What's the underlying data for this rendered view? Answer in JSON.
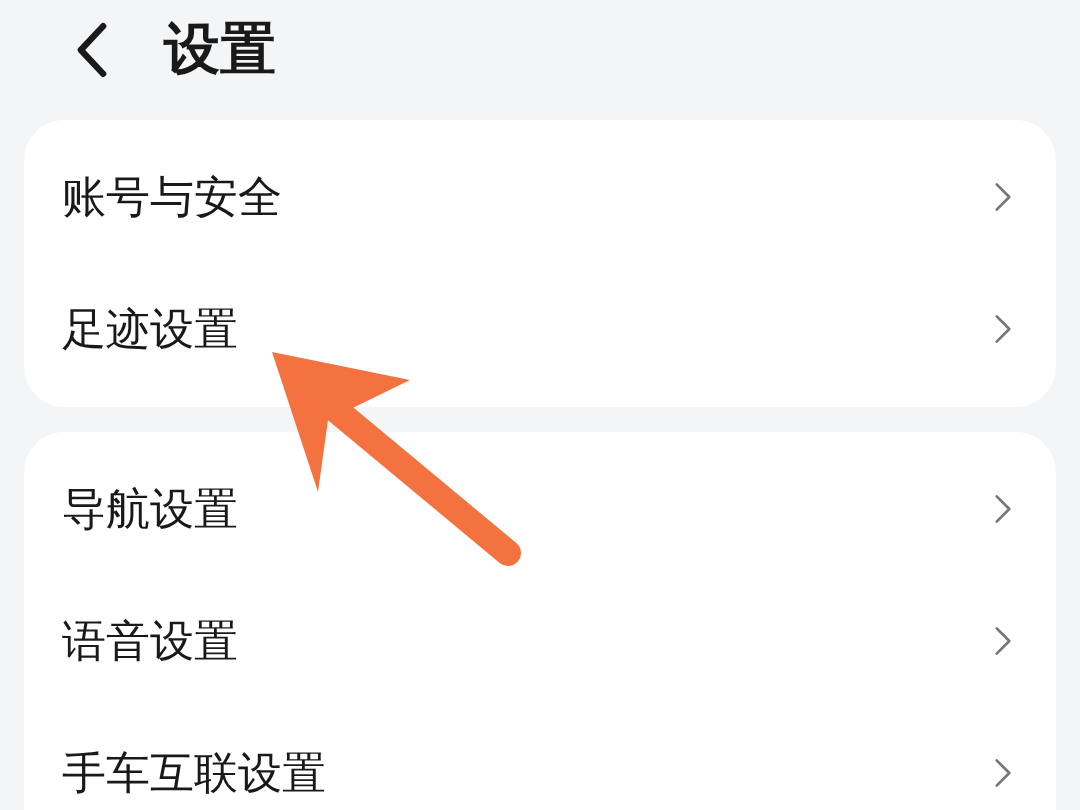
{
  "header": {
    "title": "设置"
  },
  "groups": [
    {
      "items": [
        {
          "label": "账号与安全"
        },
        {
          "label": "足迹设置"
        }
      ]
    },
    {
      "items": [
        {
          "label": "导航设置"
        },
        {
          "label": "语音设置"
        },
        {
          "label": "手车互联设置"
        }
      ]
    }
  ],
  "annotation": {
    "kind": "arrow"
  }
}
